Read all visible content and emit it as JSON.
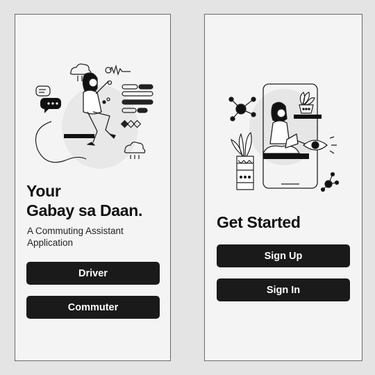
{
  "screens": {
    "welcome": {
      "headline_line1": "Your",
      "headline_line2": "Gabay sa Daan.",
      "subtitle": "A Commuting Assistant Application",
      "buttons": {
        "driver": "Driver",
        "commuter": "Commuter"
      },
      "illustration": "woman-tapping-chat-ui-illustration"
    },
    "get_started": {
      "title": "Get Started",
      "buttons": {
        "sign_up": "Sign Up",
        "sign_in": "Sign In"
      },
      "illustration": "woman-with-laptop-phone-illustration"
    }
  },
  "colors": {
    "background": "#e4e4e4",
    "screen": "#f4f4f4",
    "button": "#1a1a1a",
    "button_text": "#ffffff",
    "text": "#111111"
  }
}
